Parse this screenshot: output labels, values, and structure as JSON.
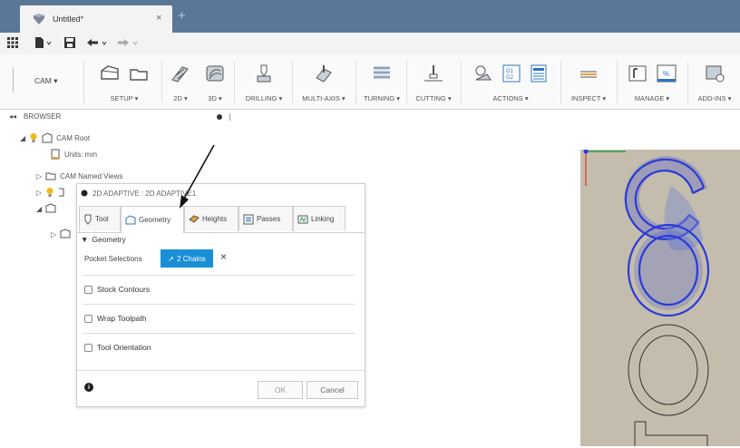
{
  "tab": {
    "title": "Untitled*",
    "close": "×",
    "new": "+"
  },
  "ribbon": {
    "workspace": "CAM ▾",
    "groups": [
      {
        "label": "SETUP ▾"
      },
      {
        "label": "2D ▾"
      },
      {
        "label": "3D ▾"
      },
      {
        "label": "DRILLING ▾"
      },
      {
        "label": "MULTI-AXIS ▾"
      },
      {
        "label": "TURNING ▾"
      },
      {
        "label": "CUTTING ▾"
      },
      {
        "label": "ACTIONS ▾"
      },
      {
        "label": "INSPECT ▾"
      },
      {
        "label": "MANAGE ▾"
      },
      {
        "label": "ADD-INS ▾"
      }
    ]
  },
  "browser": {
    "title": "BROWSER",
    "nodes": {
      "root": "CAM Root",
      "units": "Units: mm",
      "named_views": "CAM Named Views"
    }
  },
  "dialog": {
    "title": "2D ADAPTIVE : 2D ADAPTIVE1",
    "tabs": [
      "Tool",
      "Geometry",
      "Heights",
      "Passes",
      "Linking"
    ],
    "section": "Geometry",
    "pocket_label": "Pocket Selections",
    "chains_label": "2 Chains",
    "clear": "×",
    "options": [
      "Stock Contours",
      "Wrap Toolpath",
      "Tool Orientation"
    ],
    "ok": "OK",
    "cancel": "Cancel",
    "info": "i"
  },
  "colors": {
    "accent": "#1a8fd6",
    "titlebar": "#5a7797",
    "selection": "#2a3bd8",
    "viewport": "#c4bdad"
  }
}
